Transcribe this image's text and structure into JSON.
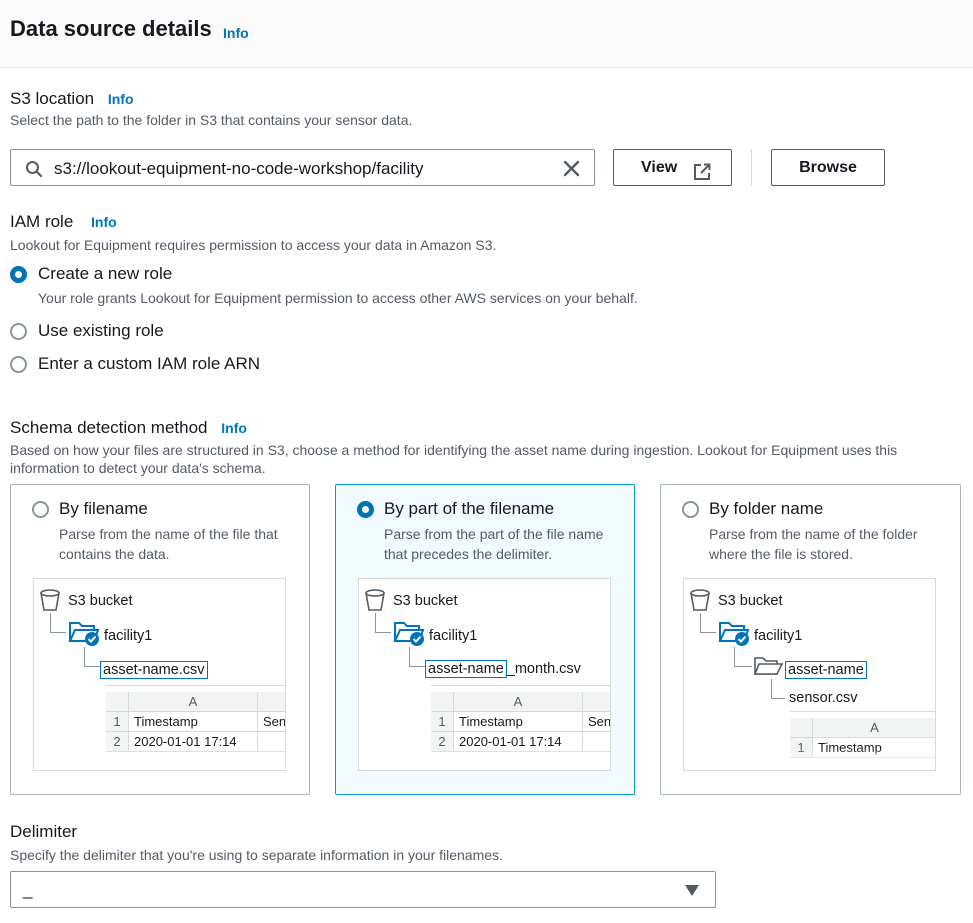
{
  "header": {
    "title": "Data source details",
    "info": "Info"
  },
  "s3": {
    "label": "S3 location",
    "info": "Info",
    "description": "Select the path to the folder in S3 that contains your sensor data.",
    "value": "s3://lookout-equipment-no-code-workshop/facility",
    "view_label": "View",
    "browse_label": "Browse"
  },
  "iam": {
    "label": "IAM role",
    "info": "Info",
    "description": "Lookout for Equipment requires permission to access your data in Amazon S3.",
    "options": [
      {
        "label": "Create a new role",
        "description": "Your role grants Lookout for Equipment permission to access other AWS services on your behalf.",
        "selected": true
      },
      {
        "label": "Use existing role",
        "selected": false
      },
      {
        "label": "Enter a custom IAM role ARN",
        "selected": false
      }
    ]
  },
  "schema": {
    "label": "Schema detection method",
    "info": "Info",
    "description": "Based on how your files are structured in S3, choose a method for identifying the asset name during ingestion. Lookout for Equipment uses this information to detect your data's schema.",
    "options": [
      {
        "title": "By filename",
        "description": "Parse from the name of the file that contains the data.",
        "selected": false
      },
      {
        "title": "By part of the filename",
        "description": "Parse from the part of the file name that precedes the delimiter.",
        "selected": true
      },
      {
        "title": "By folder name",
        "description": "Parse from the name of the folder where the file is stored.",
        "selected": false
      }
    ],
    "diagram": {
      "bucket": "S3 bucket",
      "folder": "facility1",
      "file_a": "asset-name.csv",
      "file_b_highlight": "asset-name",
      "file_b_rest": "_month.csv",
      "file_c_folder": "asset-name",
      "file_c_file": "sensor.csv",
      "col_a": "A",
      "row1_num": "1",
      "row1_val": "Timestamp",
      "row1_next": "Sen",
      "row2_num": "2",
      "row2_val": "2020-01-01 17:14"
    }
  },
  "delimiter": {
    "label": "Delimiter",
    "description": "Specify the delimiter that you're using to separate information in your filenames.",
    "value": "_"
  },
  "colors": {
    "accent": "#0073bb",
    "text": "#16191f",
    "muted": "#545b64",
    "selected_bg": "#f1faff"
  }
}
